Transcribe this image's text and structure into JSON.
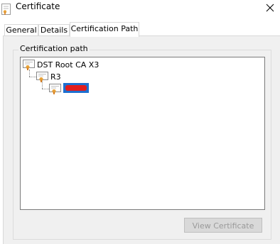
{
  "window": {
    "title": "Certificate"
  },
  "tabs": [
    {
      "label": "General"
    },
    {
      "label": "Details"
    },
    {
      "label": "Certification Path"
    }
  ],
  "certification_path": {
    "group_label": "Certification path",
    "nodes": [
      {
        "label": "DST Root CA X3"
      },
      {
        "label": "R3"
      },
      {
        "label": ""
      }
    ]
  },
  "buttons": {
    "view_certificate": "View Certificate"
  },
  "icons": {
    "title": "certificate-icon",
    "close": "close-icon",
    "node": "certificate-icon"
  },
  "colors": {
    "redaction_blue": "#1e6fd0",
    "redaction_red": "#e21d1d",
    "disabled_button_bg": "#d9d9d9",
    "disabled_button_text": "#9a9a9a"
  }
}
